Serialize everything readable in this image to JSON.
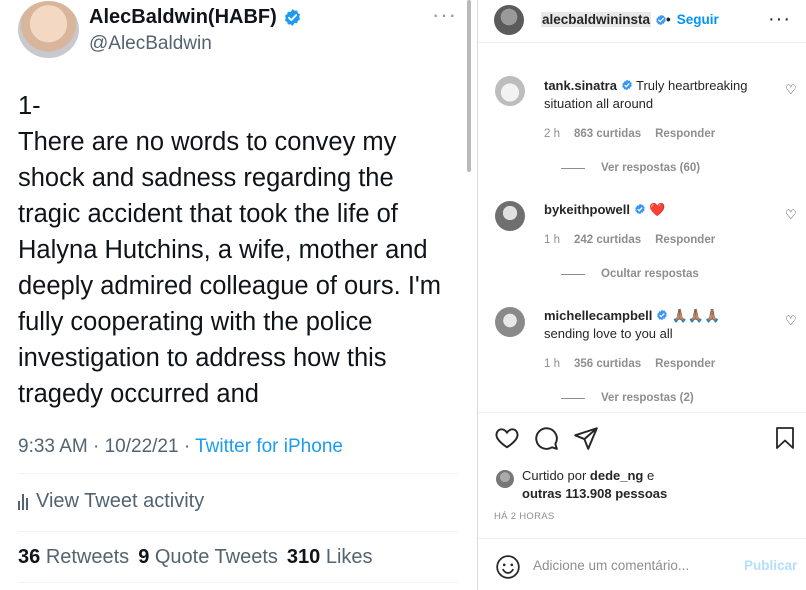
{
  "tweet": {
    "display_name": "AlecBaldwin(HABF)",
    "handle": "@AlecBaldwin",
    "body": "1-\nThere are no words to convey my shock and sadness regarding the tragic accident that took the life of Halyna Hutchins, a wife, mother and deeply admired colleague of ours. I'm fully cooperating with the police investigation to address how this tragedy occurred and",
    "timestamp": "9:33 AM · 10/22/21 · ",
    "source": "Twitter for iPhone",
    "activity_label": "View Tweet activity",
    "stats": {
      "retweets_count": "36",
      "retweets_label": "Retweets",
      "quotes_count": "9",
      "quotes_label": "Quote Tweets",
      "likes_count": "310",
      "likes_label": "Likes"
    },
    "more_icon": "more-horizontal-icon",
    "accent": "#1d9bf0"
  },
  "instagram": {
    "header": {
      "username": "alecbaldwininsta",
      "follow_label": "Seguir",
      "dot": "•"
    },
    "comments": [
      {
        "username": "tank.sinatra",
        "text": "Truly heartbreaking situation all around",
        "time": "2 h",
        "likes": "863 curtidas",
        "reply": "Responder",
        "replies_label": "Ver respostas (60)"
      },
      {
        "username": "bykeithpowell",
        "text": "❤️",
        "time": "1 h",
        "likes": "242 curtidas",
        "reply": "Responder",
        "replies_label": "Ocultar respostas"
      },
      {
        "username": "michellecampbell",
        "text": "🙏🏽🙏🏽🙏🏽",
        "text2": "sending love to you all",
        "time": "1 h",
        "likes": "356 curtidas",
        "reply": "Responder",
        "replies_label": "Ver respostas (2)"
      }
    ],
    "liked_by": {
      "prefix": "Curtido por ",
      "user": "dede_ng",
      "middle": " e",
      "others": "outras 113.908 pessoas"
    },
    "time_ago": "HÁ 2 HORAS",
    "comment_placeholder": "Adicione um comentário...",
    "post_label": "Publicar",
    "accent": "#0095f6"
  }
}
